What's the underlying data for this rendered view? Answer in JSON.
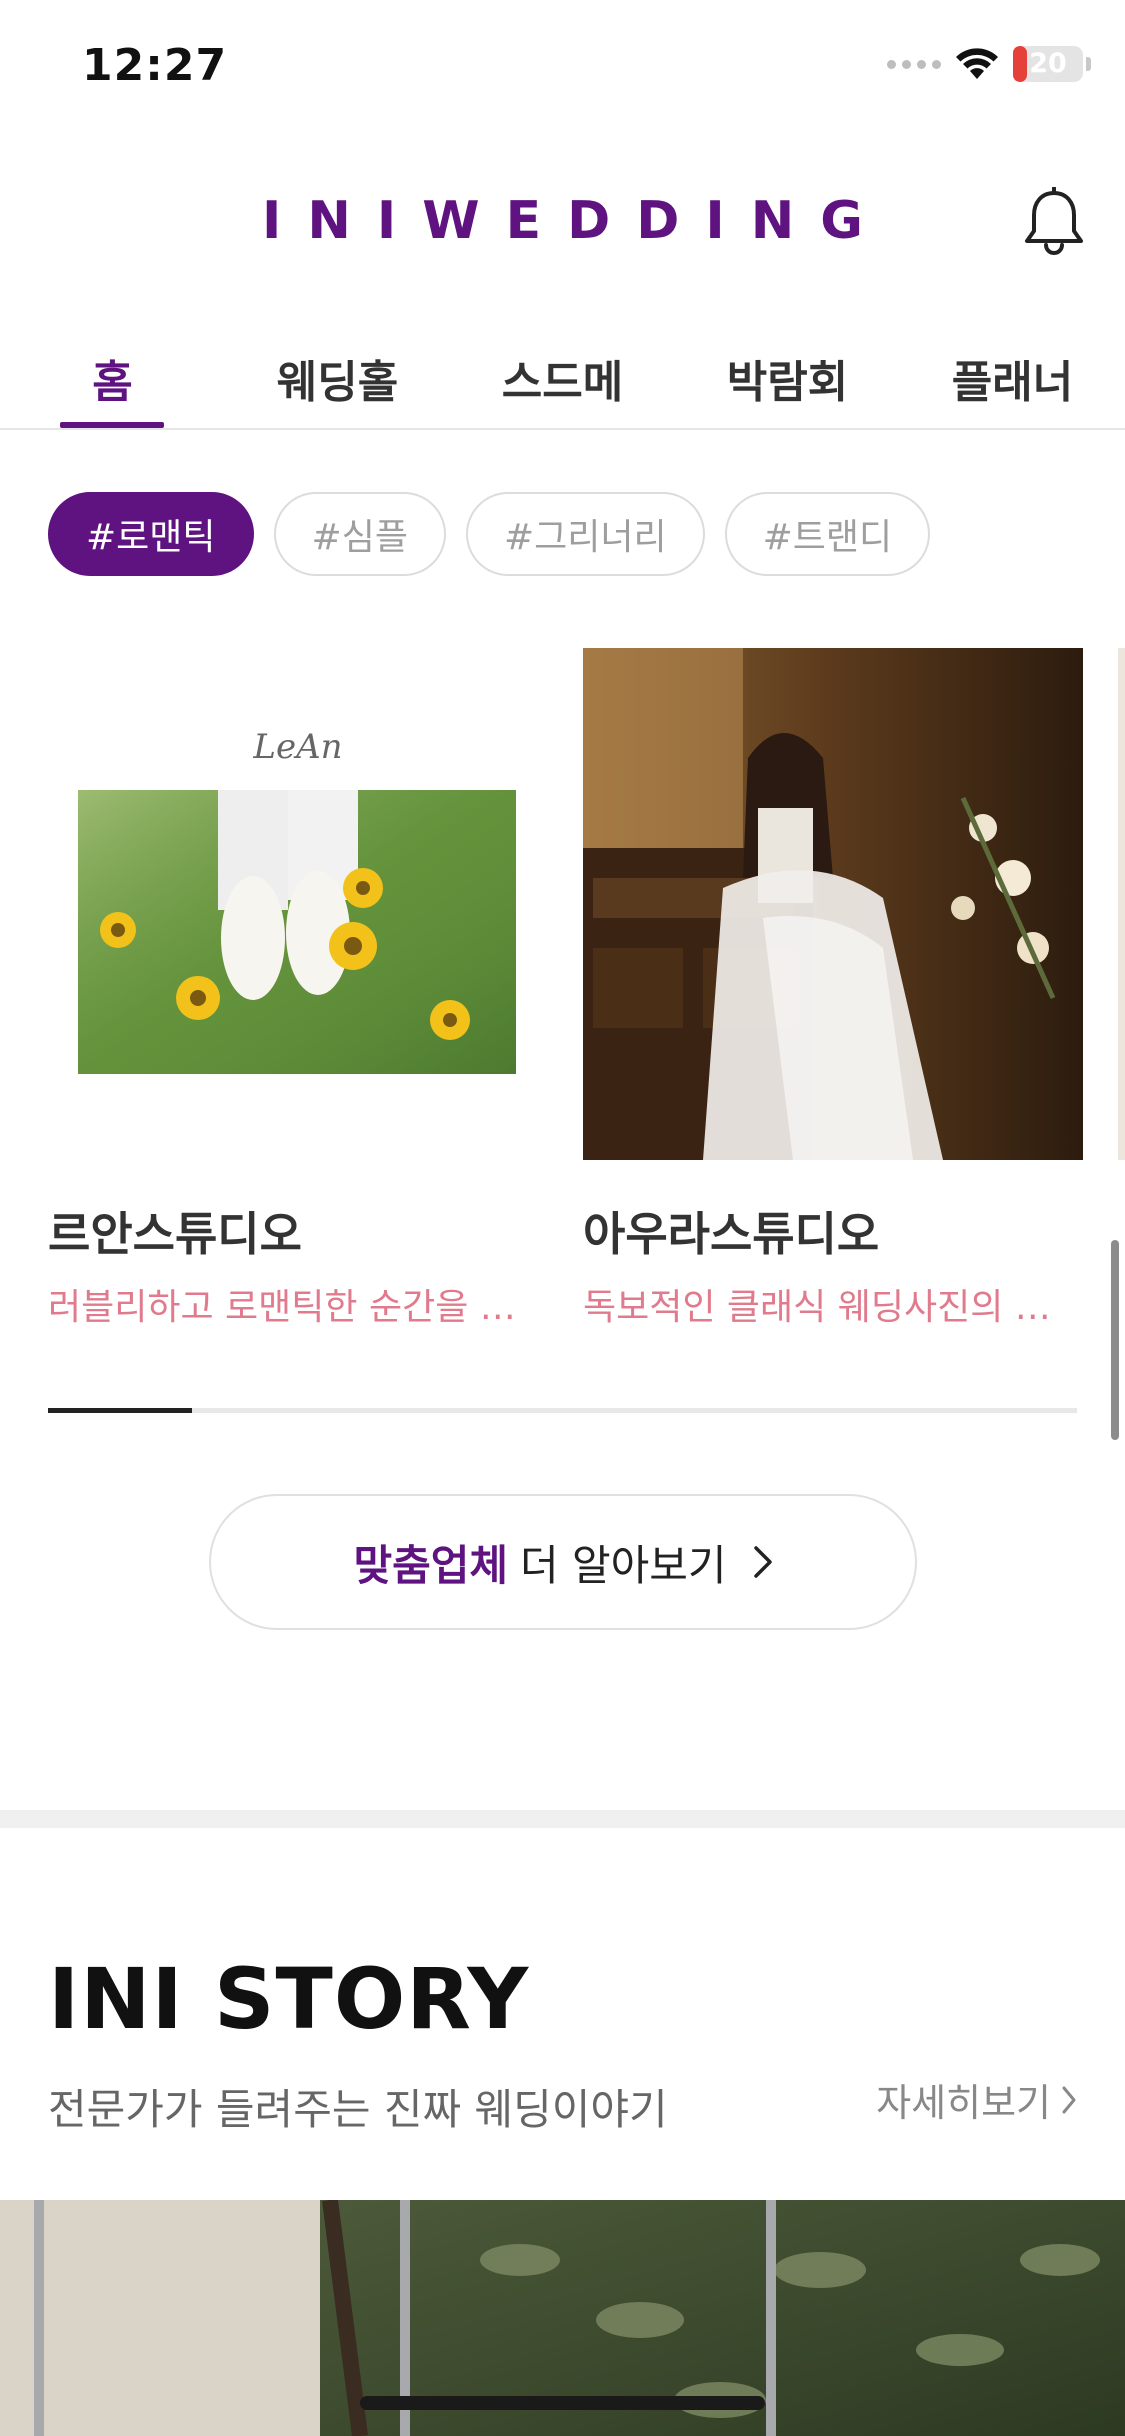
{
  "status_bar": {
    "time": "12:27",
    "battery_level": "20",
    "battery_fraction": 0.2
  },
  "header": {
    "logo": "INIWEDDING",
    "bell_icon": "bell-icon"
  },
  "tabs": [
    {
      "label": "홈",
      "active": true
    },
    {
      "label": "웨딩홀",
      "active": false
    },
    {
      "label": "스드메",
      "active": false
    },
    {
      "label": "박람회",
      "active": false
    },
    {
      "label": "플래너",
      "active": false
    }
  ],
  "chips": [
    {
      "label": "#로맨틱",
      "active": true
    },
    {
      "label": "#심플",
      "active": false
    },
    {
      "label": "#그리너리",
      "active": false
    },
    {
      "label": "#트랜디",
      "active": false
    }
  ],
  "cards": [
    {
      "name": "르안스튜디오",
      "desc": "러블리하고 로맨틱한 순간을 담아내는 스튜디오",
      "image_caption": "LeAn"
    },
    {
      "name": "아우라스튜디오",
      "desc": "독보적인 클래식 웨딩사진의 '아우라'",
      "image_caption": ""
    }
  ],
  "carousel_progress": 0.14,
  "more_button": {
    "strong": "맞춤업체",
    "rest": "더 알아보기",
    "icon": "chevron-right-icon"
  },
  "story": {
    "title": "INI STORY",
    "subtitle": "전문가가 들려주는 진짜 웨딩이야기",
    "more_label": "자세히보기",
    "more_icon": "chevron-right-icon"
  },
  "colors": {
    "brand": "#5e1380",
    "desc_pink": "#e07a8c",
    "battery_low": "#e5413a"
  }
}
